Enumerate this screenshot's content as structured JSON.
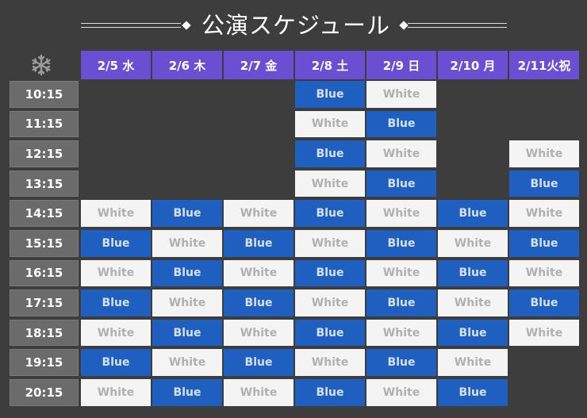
{
  "title": "公演スケジュール",
  "colors": {
    "background": "#3d3d3d",
    "day_header": "#6a4fd3",
    "blue_slot": "#1f5fbf",
    "white_slot": "#f4f4f4",
    "time_label": "#6b6b6b"
  },
  "corner_icon": "snowflake-icon",
  "days": [
    "2/5 水",
    "2/6 木",
    "2/7 金",
    "2/8 土",
    "2/9 日",
    "2/10 月",
    "2/11火祝"
  ],
  "times": [
    "10:15",
    "11:15",
    "12:15",
    "13:15",
    "14:15",
    "15:15",
    "16:15",
    "17:15",
    "18:15",
    "19:15",
    "20:15"
  ],
  "schedule": [
    [
      "",
      "",
      "",
      "Blue",
      "White",
      "",
      ""
    ],
    [
      "",
      "",
      "",
      "White",
      "Blue",
      "",
      ""
    ],
    [
      "",
      "",
      "",
      "Blue",
      "White",
      "",
      "White"
    ],
    [
      "",
      "",
      "",
      "White",
      "Blue",
      "",
      "Blue"
    ],
    [
      "White",
      "Blue",
      "White",
      "Blue",
      "White",
      "Blue",
      "White"
    ],
    [
      "Blue",
      "White",
      "Blue",
      "White",
      "Blue",
      "White",
      "Blue"
    ],
    [
      "White",
      "Blue",
      "White",
      "Blue",
      "White",
      "Blue",
      "White"
    ],
    [
      "Blue",
      "White",
      "Blue",
      "White",
      "Blue",
      "White",
      "Blue"
    ],
    [
      "White",
      "Blue",
      "White",
      "Blue",
      "White",
      "Blue",
      "White"
    ],
    [
      "Blue",
      "White",
      "Blue",
      "White",
      "Blue",
      "White",
      ""
    ],
    [
      "White",
      "Blue",
      "White",
      "Blue",
      "White",
      "Blue",
      ""
    ]
  ]
}
